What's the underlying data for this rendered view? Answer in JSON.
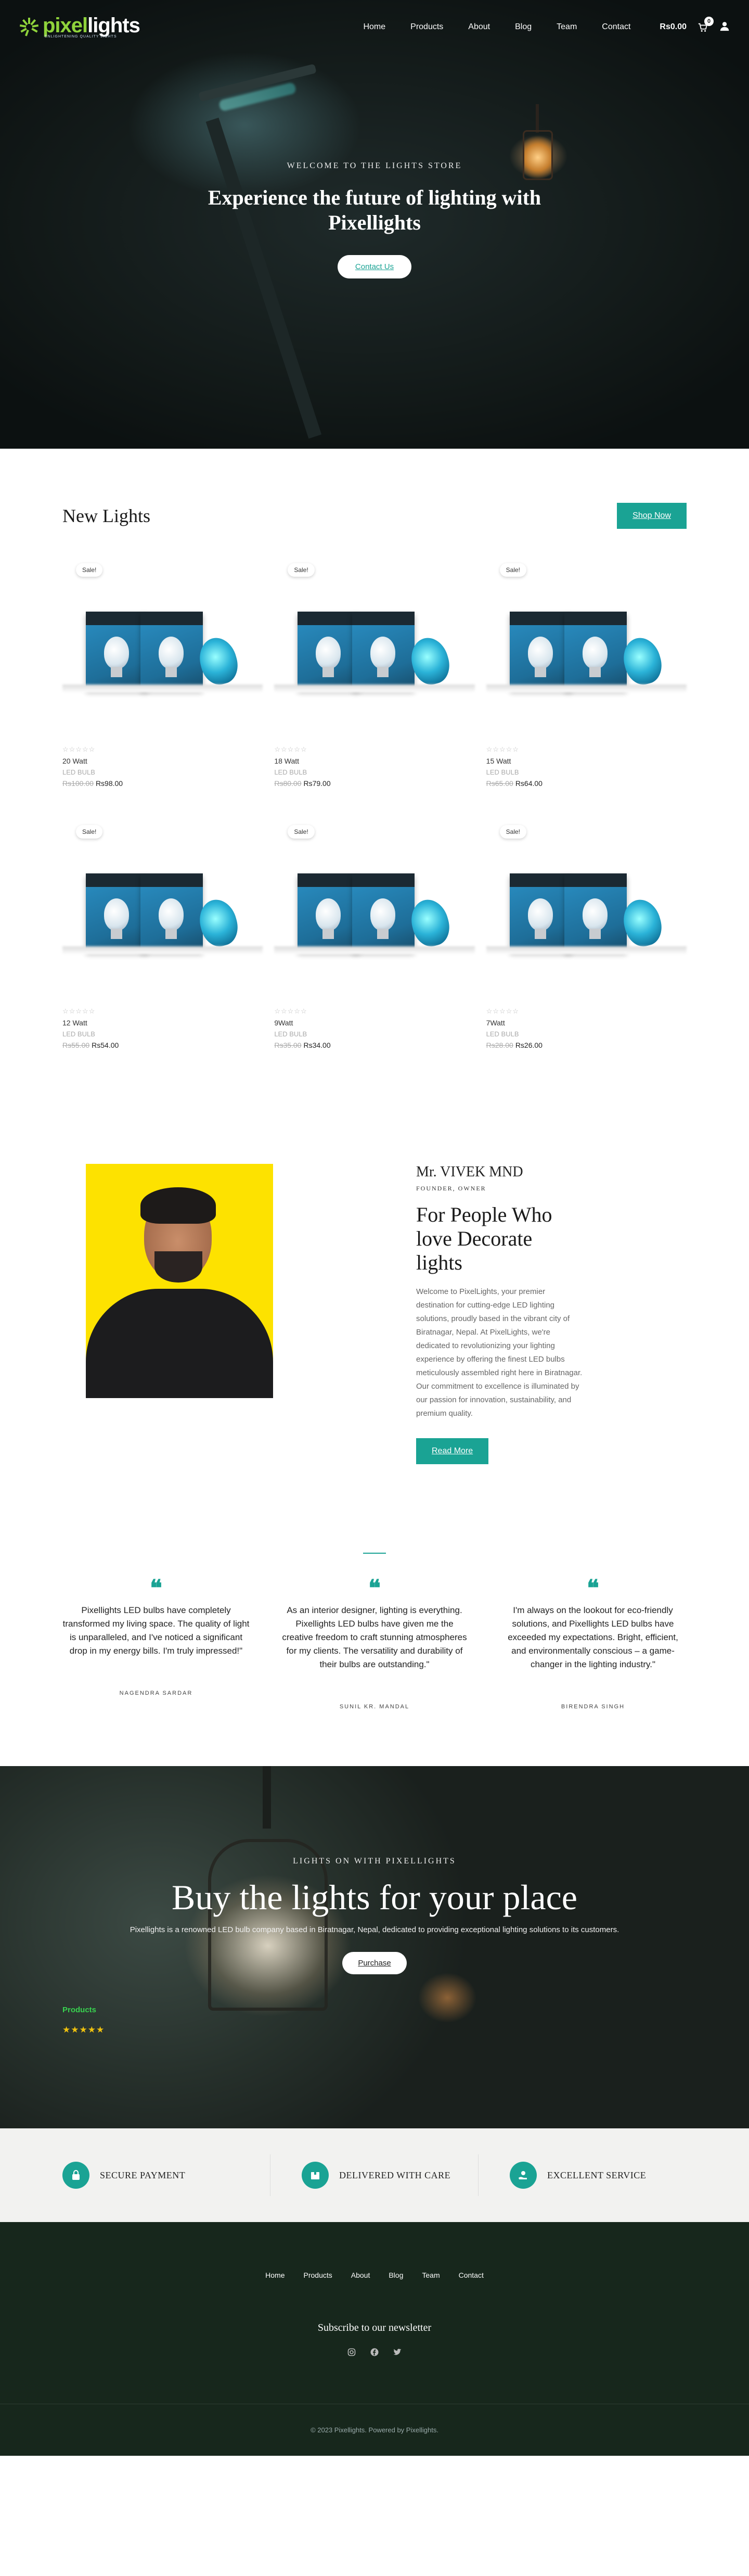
{
  "header": {
    "logo_name_a": "pixel",
    "logo_name_b": "lights",
    "logo_tagline": "ENLIGHTENING QUALITY LIGHTS",
    "menu": [
      "Home",
      "Products",
      "About",
      "Blog",
      "Team",
      "Contact"
    ],
    "cart_total": "Rs0.00",
    "cart_count": "0",
    "cart_icon": "cart-icon",
    "user_icon": "user-icon"
  },
  "hero": {
    "eyebrow": "WELCOME TO THE LIGHTS STORE",
    "title": "Experience the future of lighting with Pixellights",
    "button": "Contact Us"
  },
  "new_lights": {
    "title": "New Lights",
    "button": "Shop Now",
    "products": [
      {
        "badge": "Sale!",
        "name": "20 Watt",
        "category": "LED BULB",
        "old_price": "Rs100.00",
        "price": "Rs98.00",
        "rating": 0
      },
      {
        "badge": "Sale!",
        "name": "18 Watt",
        "category": "LED BULB",
        "old_price": "Rs80.00",
        "price": "Rs79.00",
        "rating": 0
      },
      {
        "badge": "Sale!",
        "name": "15 Watt",
        "category": "LED BULB",
        "old_price": "Rs65.00",
        "price": "Rs64.00",
        "rating": 0
      },
      {
        "badge": "Sale!",
        "name": "12 Watt",
        "category": "LED BULB",
        "old_price": "Rs55.00",
        "price": "Rs54.00",
        "rating": 0
      },
      {
        "badge": "Sale!",
        "name": "9Watt",
        "category": "LED BULB",
        "old_price": "Rs35.00",
        "price": "Rs34.00",
        "rating": 0
      },
      {
        "badge": "Sale!",
        "name": "7Watt",
        "category": "LED BULB",
        "old_price": "Rs28.00",
        "price": "Rs26.00",
        "rating": 0
      }
    ]
  },
  "owner": {
    "name": "Mr. VIVEK MND",
    "role": "FOUNDER, OWNER",
    "heading": "For People Who love Decorate lights",
    "body": "Welcome to PixelLights, your premier destination for cutting-edge LED lighting solutions, proudly based in the vibrant city of Biratnagar, Nepal. At PixelLights, we're dedicated to revolutionizing your lighting experience by offering the finest LED bulbs meticulously assembled right here in Biratnagar. Our commitment to excellence is illuminated by our passion for innovation, sustainability, and premium quality.",
    "button": "Read More"
  },
  "testimonials": [
    {
      "text": "Pixellights LED bulbs have completely transformed my living space. The quality of light is unparalleled, and I've noticed a significant drop in my energy bills. I'm truly impressed!\"",
      "name": "NAGENDRA SARDAR"
    },
    {
      "text": "As an interior designer, lighting is everything. Pixellights LED bulbs have given me the creative freedom to craft stunning atmospheres for my clients. The versatility and durability of their bulbs are outstanding.\"",
      "name": "SUNIL KR. MANDAL"
    },
    {
      "text": "I'm always on the lookout for eco-friendly solutions, and Pixellights LED bulbs have exceeded my expectations. Bright, efficient, and environmentally conscious – a game-changer in the lighting industry.\"",
      "name": "BIRENDRA SINGH"
    }
  ],
  "cta": {
    "eyebrow": "LIGHTS ON WITH PIXELLIGHTS",
    "title": "Buy the lights for your place",
    "subtitle": "Pixellights is a renowned LED bulb company based in Biratnagar, Nepal, dedicated to providing exceptional lighting solutions to its customers.",
    "button": "Purchase",
    "products_label": "Products",
    "rating": 5,
    "rating_stars": "★★★★★"
  },
  "features": [
    {
      "label": "SECURE PAYMENT",
      "icon": "lock-icon"
    },
    {
      "label": "DELIVERED WITH CARE",
      "icon": "package-icon"
    },
    {
      "label": "EXCELLENT SERVICE",
      "icon": "service-hand-icon"
    }
  ],
  "footer": {
    "menu": [
      "Home",
      "Products",
      "About",
      "Blog",
      "Team",
      "Contact"
    ],
    "newsletter": "Subscribe to our newsletter",
    "socials": [
      "instagram-icon",
      "facebook-icon",
      "twitter-icon"
    ],
    "copyright": "© 2023 Pixellights. Powered by Pixellights."
  },
  "colors": {
    "accent": "#1aa394",
    "logo_green": "#8fd33b",
    "footer_bg": "#17271c",
    "rating_gold": "#f0c20e",
    "products_label_green": "#38d24f"
  }
}
